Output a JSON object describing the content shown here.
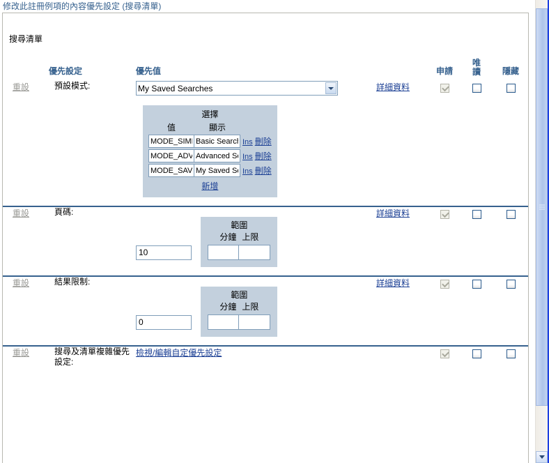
{
  "page": {
    "title": "修改此註冊例項的內容優先設定 (搜尋清單)",
    "section_title": "搜尋清單"
  },
  "table_headers": {
    "reset": "",
    "preference": "優先設定",
    "value": "優先值",
    "apply": "申請",
    "readonly": "唯讀",
    "hidden": "隱藏"
  },
  "common": {
    "reset_label": "重設",
    "detail_label": "詳細資料",
    "add_label": "新增",
    "ins_label": "Ins",
    "delete_label": "刪除"
  },
  "choices_panel": {
    "title": "選擇",
    "col_value": "值",
    "col_display": "顯示",
    "rows": [
      {
        "value": "MODE_SIMPLE",
        "display": "Basic Search"
      },
      {
        "value": "MODE_ADVANCED",
        "display": "Advanced Search"
      },
      {
        "value": "MODE_SAVED",
        "display": "My Saved Searches"
      }
    ]
  },
  "range_panel": {
    "title": "範圍",
    "col_min": "分鐘",
    "col_max": "上限",
    "min_value": "",
    "max_value": ""
  },
  "rows": [
    {
      "id": "default-mode",
      "name": "預設模式:",
      "control": "select",
      "selected": "My Saved Searches",
      "options": [
        "Basic Search",
        "Advanced Search",
        "My Saved Searches"
      ],
      "apply_checked": true,
      "apply_disabled": true,
      "readonly_checked": false,
      "hidden_checked": false
    },
    {
      "id": "page-size",
      "name": "頁碼:",
      "control": "text",
      "value": "10",
      "apply_checked": true,
      "apply_disabled": true,
      "readonly_checked": false,
      "hidden_checked": false
    },
    {
      "id": "result-limit",
      "name": "結果限制:",
      "control": "text",
      "value": "0",
      "apply_checked": true,
      "apply_disabled": true,
      "readonly_checked": false,
      "hidden_checked": false
    },
    {
      "id": "complex-prefs",
      "name": "搜尋及清單複雜優先設定:",
      "control": "link",
      "link_label": "檢視/編輯自定優先設定",
      "apply_checked": true,
      "apply_disabled": true,
      "readonly_checked": false,
      "hidden_checked": false
    }
  ],
  "scrollbar": {
    "down_arrow": "chevron-down-icon"
  }
}
